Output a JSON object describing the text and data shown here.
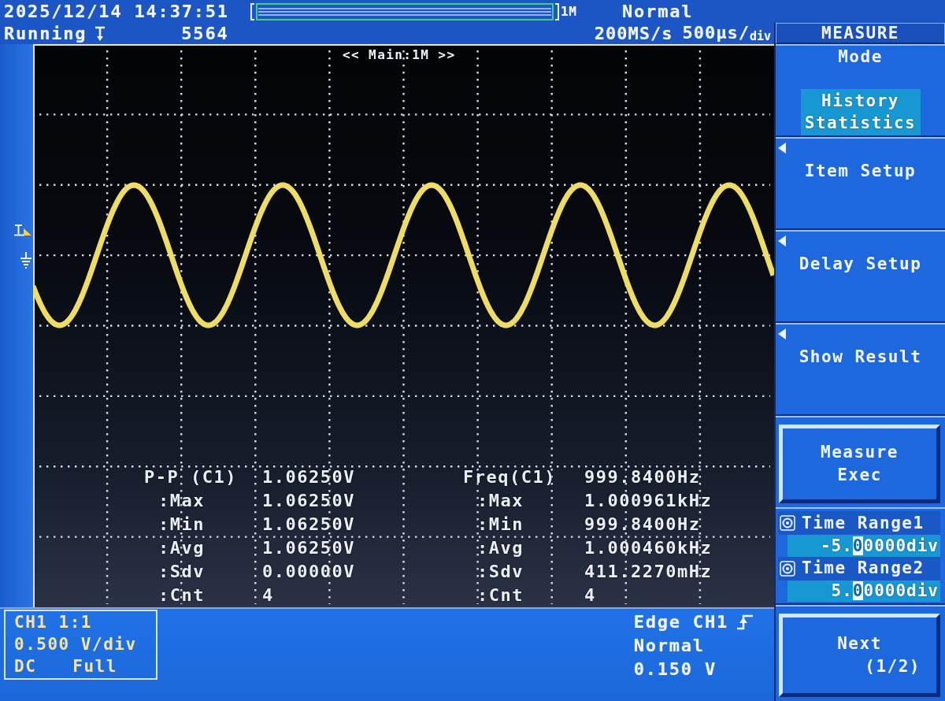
{
  "status_bar": {
    "datetime": "2025/12/14 14:37:51",
    "memory_depth": "1M",
    "trigger_mode": "Normal",
    "run_state": "Running",
    "acquisition_count": "5564",
    "sample_rate": "200MS/s",
    "timebase": "500µs/$_{div}$"
  },
  "menu": {
    "title": "MEASURE",
    "items": [
      {
        "kind": "selector",
        "label": "Mode",
        "value": "History Statistics"
      },
      {
        "kind": "submenu",
        "label": "Item Setup"
      },
      {
        "kind": "submenu",
        "label": "Delay Setup"
      },
      {
        "kind": "submenu",
        "label": "Show Result"
      },
      {
        "kind": "button",
        "label": "Measure Exec"
      },
      {
        "kind": "ranges",
        "ranges": [
          {
            "label": "Time Range1",
            "value": {
              "before": "-5.",
              "cursor": "0",
              "after": "0000div"
            }
          },
          {
            "label": "Time Range2",
            "value": {
              "before": "5.",
              "cursor": "0",
              "after": "0000div"
            }
          }
        ]
      },
      {
        "kind": "button",
        "label": "Next",
        "page": "(1/2)"
      }
    ]
  },
  "screen": {
    "window_label": "<< Main:1M >>",
    "measurements": [
      {
        "name": "P-P (C1)",
        "value": "1.06250V",
        "stats": [
          {
            "label": ":Max",
            "value": "1.06250V"
          },
          {
            "label": ":Min",
            "value": "1.06250V"
          },
          {
            "label": ":Avg",
            "value": "1.06250V"
          },
          {
            "label": ":Sdv",
            "value": "0.00000V"
          },
          {
            "label": ":Cnt",
            "value": "4"
          }
        ]
      },
      {
        "name": "Freq(C1)",
        "value": "999.8400Hz",
        "stats": [
          {
            "label": ":Max",
            "value": "1.000961kHz"
          },
          {
            "label": ":Min",
            "value": "999.8400Hz"
          },
          {
            "label": ":Avg",
            "value": "1.000460kHz"
          },
          {
            "label": ":Sdv",
            "value": "411.2270mHz"
          },
          {
            "label": ":Cnt",
            "value": "4"
          }
        ]
      }
    ]
  },
  "channel": {
    "title": "CH1 1:1",
    "scale": "0.500 V/div",
    "coupling": "DC",
    "bandwidth": "Full"
  },
  "trigger": {
    "type": "Edge CH1",
    "mode": "Normal",
    "threshold": "0.150 V"
  }
}
